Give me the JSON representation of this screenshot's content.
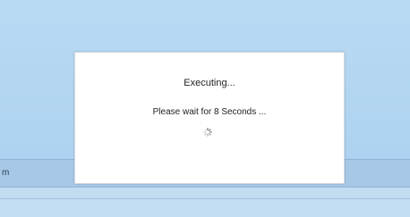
{
  "background": {
    "strip_label": "m"
  },
  "dialog": {
    "title": "Executing...",
    "message": "Please wait for 8 Seconds ...",
    "spinner_icon": "loading-spinner-icon"
  },
  "colors": {
    "background": "#b7d7f0",
    "dialog": "#ffffff",
    "text": "#222222"
  }
}
